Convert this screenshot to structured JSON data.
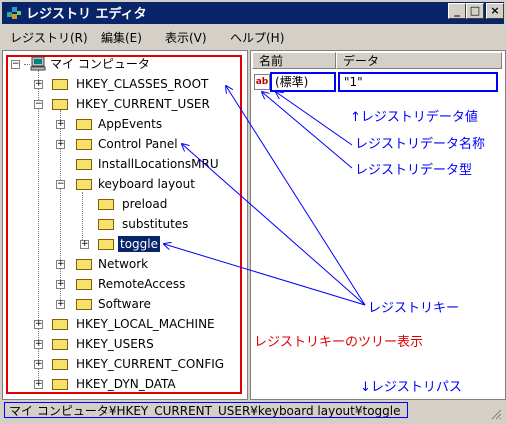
{
  "window": {
    "title": "レジストリ エディタ"
  },
  "caption_buttons": {
    "minimize": "_",
    "maximize": "□",
    "close": "×"
  },
  "menu": [
    {
      "label": "レジストリ(R)"
    },
    {
      "label": "編集(E)"
    },
    {
      "label": "表示(V)"
    },
    {
      "label": "ヘルプ(H)"
    }
  ],
  "tree": {
    "root": "マイ コンピュータ",
    "items": [
      "HKEY_CLASSES_ROOT",
      "HKEY_CURRENT_USER",
      "AppEvents",
      "Control Panel",
      "InstallLocationsMRU",
      "keyboard layout",
      "preload",
      "substitutes",
      "toggle",
      "Network",
      "RemoteAccess",
      "Software",
      "HKEY_LOCAL_MACHINE",
      "HKEY_USERS",
      "HKEY_CURRENT_CONFIG",
      "HKEY_DYN_DATA"
    ],
    "selected": "toggle"
  },
  "list": {
    "columns": [
      "名前",
      "データ"
    ],
    "rows": [
      {
        "icon": "ab",
        "name": "(標準)",
        "data": "\"1\""
      }
    ]
  },
  "annotations": {
    "value": "↑レジストリデータ値",
    "name": "レジストリデータ名称",
    "type": "レジストリデータ型",
    "key": "レジストリキー",
    "tree": "レジストリキーのツリー表示",
    "path": "↓レジストリパス"
  },
  "status": {
    "path": "マイ コンピュータ¥HKEY_CURRENT_USER¥keyboard layout¥toggle"
  },
  "colors": {
    "annotation": "#0000ff",
    "tree_annotation": "#ff0000",
    "title_bar": "#0a246a"
  }
}
